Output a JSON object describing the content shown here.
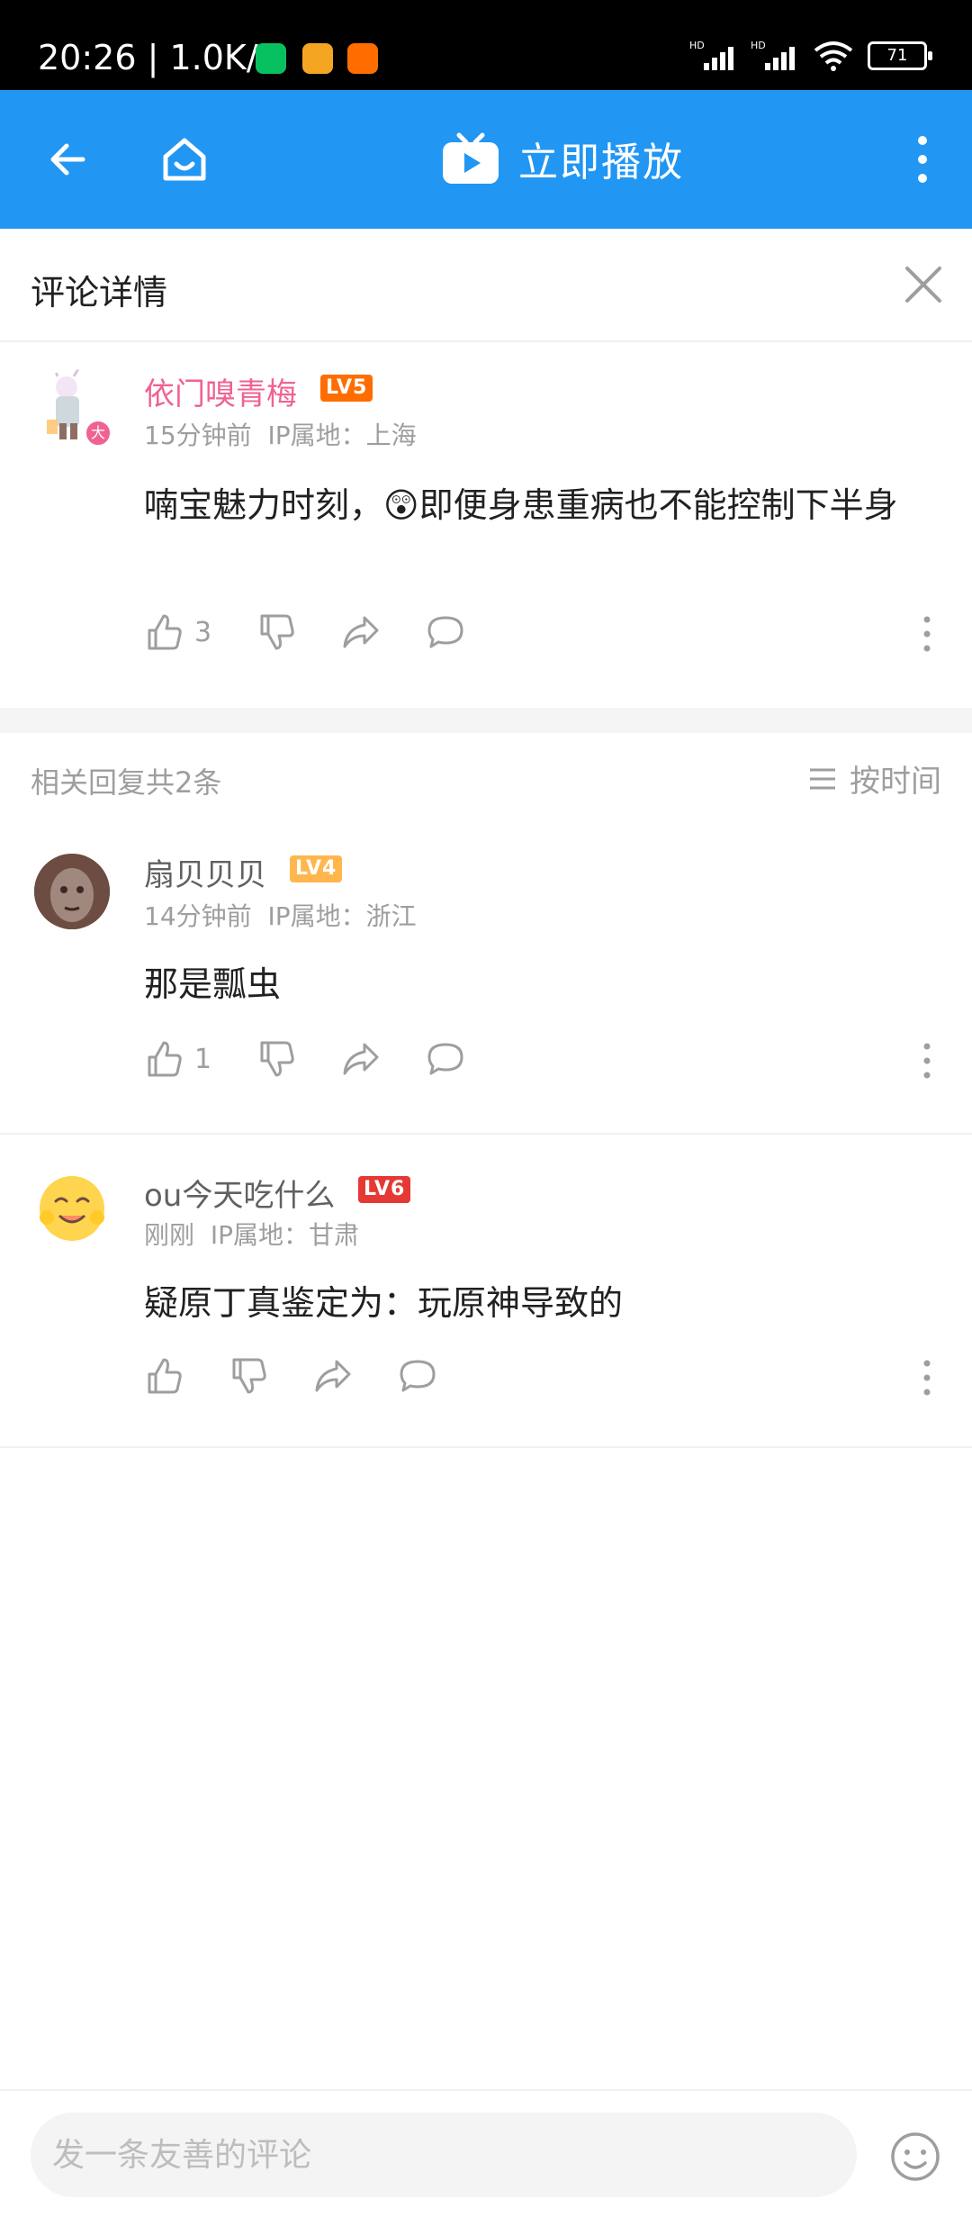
{
  "status_bar": {
    "time": "20:26 | 1.0K/s",
    "network_label": "HD",
    "battery": "71"
  },
  "top_bar": {
    "play_label": "立即播放"
  },
  "detail": {
    "title": "评论详情"
  },
  "main_comment": {
    "username": "依门嗅青梅",
    "level": "LV5",
    "time": "15分钟前",
    "ip": "IP属地：上海",
    "text": "喃宝魅力时刻，😲即便身患重病也不能控制下半身",
    "like_count": "3",
    "username_color": "#f06292",
    "level_color": "#ff6d00"
  },
  "replies": {
    "count_label": "相关回复共2条",
    "sort_label": "按时间"
  },
  "reply_list": [
    {
      "username": "扇贝贝贝",
      "level": "LV4",
      "time": "14分钟前",
      "ip": "IP属地：浙江",
      "text": "那是瓢虫",
      "like_count": "1",
      "level_color": "#ffb74d"
    },
    {
      "username": "ou今天吃什么",
      "level": "LV6",
      "time": "刚刚",
      "ip": "IP属地：甘肃",
      "text": "疑原丁真鉴定为：玩原神导致的",
      "like_count": "",
      "level_color": "#e53935"
    }
  ],
  "bottom_bar": {
    "input_placeholder": "发一条友善的评论"
  },
  "colors": {
    "brand": "#2196f3",
    "text_primary": "#212121",
    "text_secondary": "#9e9e9e"
  }
}
